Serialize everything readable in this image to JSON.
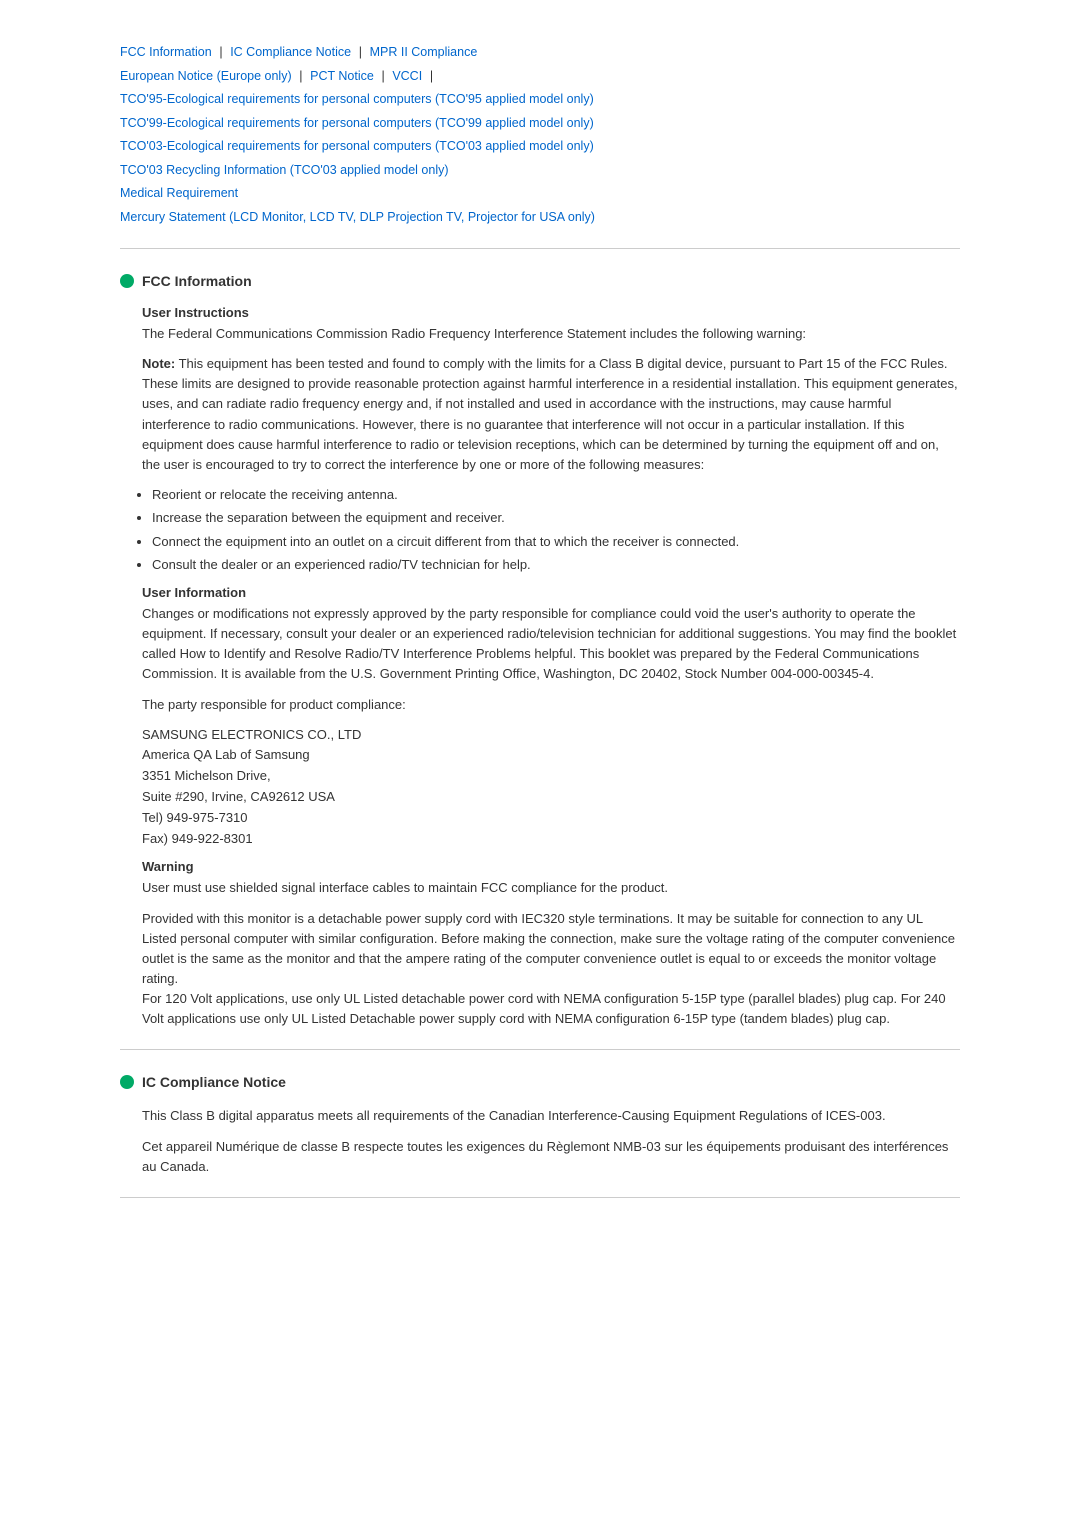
{
  "nav": {
    "links": [
      {
        "label": "FCC Information",
        "id": "fcc"
      },
      {
        "label": "IC Compliance Notice",
        "id": "ic"
      },
      {
        "label": "MPR II Compliance",
        "id": "mpr"
      },
      {
        "label": "European Notice (Europe only)",
        "id": "eu"
      },
      {
        "label": "PCT Notice",
        "id": "pct"
      },
      {
        "label": "VCCI",
        "id": "vcci"
      },
      {
        "label": "TCO'95-Ecological requirements for personal computers (TCO'95 applied model only)",
        "id": "tco95"
      },
      {
        "label": "TCO'99-Ecological requirements for personal computers (TCO'99 applied model only)",
        "id": "tco99"
      },
      {
        "label": "TCO'03-Ecological requirements for personal computers (TCO'03 applied model only)",
        "id": "tco03"
      },
      {
        "label": "TCO'03 Recycling Information (TCO'03 applied model only)",
        "id": "tco03r"
      },
      {
        "label": "Medical Requirement",
        "id": "medical"
      },
      {
        "label": "Mercury Statement (LCD Monitor, LCD TV, DLP Projection TV, Projector for USA only)",
        "id": "mercury"
      }
    ]
  },
  "fcc_section": {
    "title": "FCC Information",
    "user_instructions": {
      "heading": "User Instructions",
      "para1": "The Federal Communications Commission Radio Frequency Interference Statement includes the following warning:",
      "para2_bold": "Note:",
      "para2_rest": " This equipment has been tested and found to comply with the limits for a Class B digital device, pursuant to Part 15 of the FCC Rules. These limits are designed to provide reasonable protection against harmful interference in a residential installation. This equipment generates, uses, and can radiate radio frequency energy and, if not installed and used in accordance with the instructions, may cause harmful interference to radio communications. However, there is no guarantee that interference will not occur in a particular installation. If this equipment does cause harmful interference to radio or television receptions, which can be determined by turning the equipment off and on, the user is encouraged to try to correct the interference by one or more of the following measures:",
      "bullets": [
        "Reorient or relocate the receiving antenna.",
        "Increase the separation between the equipment and receiver.",
        "Connect the equipment into an outlet on a circuit different from that to which the receiver is connected.",
        "Consult the dealer or an experienced radio/TV technician for help."
      ]
    },
    "user_information": {
      "heading": "User Information",
      "para1": "Changes or modifications not expressly approved by the party responsible for compliance could void the user's authority to operate the equipment. If necessary, consult your dealer or an experienced radio/television technician for additional suggestions. You may find the booklet called How to Identify and Resolve Radio/TV Interference Problems helpful. This booklet was prepared by the Federal Communications Commission. It is available from the U.S. Government Printing Office, Washington, DC 20402, Stock Number 004-000-00345-4.",
      "para2": "The party responsible for product compliance:",
      "address": "SAMSUNG ELECTRONICS CO., LTD\nAmerica QA Lab of Samsung\n3351 Michelson Drive,\nSuite #290, Irvine, CA92612 USA\nTel) 949-975-7310\nFax) 949-922-8301"
    },
    "warning": {
      "heading": "Warning",
      "para1": "User must use shielded signal interface cables to maintain FCC compliance for the product.",
      "para2": "Provided with this monitor is a detachable power supply cord with IEC320 style terminations. It may be suitable for connection to any UL Listed personal computer with similar configuration. Before making the connection, make sure the voltage rating of the computer convenience outlet is the same as the monitor and that the ampere rating of the computer convenience outlet is equal to or exceeds the monitor voltage rating.\nFor 120 Volt applications, use only UL Listed detachable power cord with NEMA configuration 5-15P type (parallel blades) plug cap. For 240 Volt applications use only UL Listed Detachable power supply cord with NEMA configuration 6-15P type (tandem blades) plug cap."
    }
  },
  "ic_section": {
    "title": "IC Compliance Notice",
    "para1": "This Class B digital apparatus meets all requirements of the Canadian Interference-Causing Equipment Regulations of ICES-003.",
    "para2": "Cet appareil Numérique de classe B respecte toutes les exigences du Règlemont NMB-03 sur les équipements produisant des interférences au Canada."
  }
}
